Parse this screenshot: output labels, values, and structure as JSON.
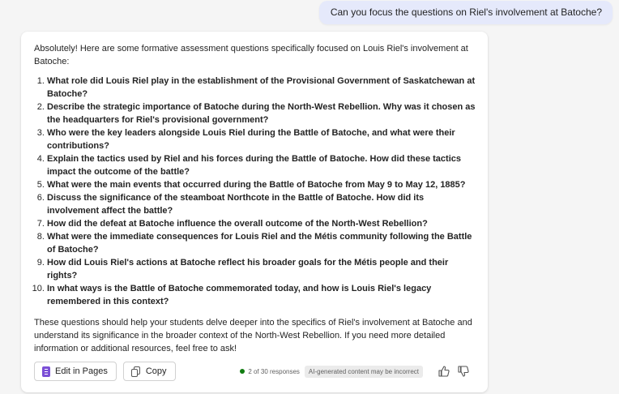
{
  "user_message": "Can you focus the questions on Riel's involvement at Batoche?",
  "response": {
    "intro": "Absolutely! Here are some formative assessment questions specifically focused on Louis Riel's involvement at Batoche:",
    "questions": [
      "What role did Louis Riel play in the establishment of the Provisional Government of Saskatchewan at Batoche?",
      "Describe the strategic importance of Batoche during the North-West Rebellion. Why was it chosen as the headquarters for Riel's provisional government?",
      "Who were the key leaders alongside Louis Riel during the Battle of Batoche, and what were their contributions?",
      "Explain the tactics used by Riel and his forces during the Battle of Batoche. How did these tactics impact the outcome of the battle?",
      "What were the main events that occurred during the Battle of Batoche from May 9 to May 12, 1885?",
      "Discuss the significance of the steamboat Northcote in the Battle of Batoche. How did its involvement affect the battle?",
      "How did the defeat at Batoche influence the overall outcome of the North-West Rebellion?",
      "What were the immediate consequences for Louis Riel and the Métis community following the Battle of Batoche?",
      "How did Louis Riel's actions at Batoche reflect his broader goals for the Métis people and their rights?",
      "In what ways is the Battle of Batoche commemorated today, and how is Louis Riel's legacy remembered in this context?"
    ],
    "outro": "These questions should help your students delve deeper into the specifics of Riel's involvement at Batoche and understand its significance in the broader context of the North-West Rebellion. If you need more detailed information or additional resources, feel free to ask!"
  },
  "footer": {
    "edit_label": "Edit in Pages",
    "copy_label": "Copy",
    "responses": "2 of 30 responses",
    "ai_notice": "AI-generated content may be incorrect"
  },
  "colors": {
    "user_bubble": "#e5e9fb",
    "pages_icon": "#7b4fd6",
    "status_dot": "#107c10"
  }
}
